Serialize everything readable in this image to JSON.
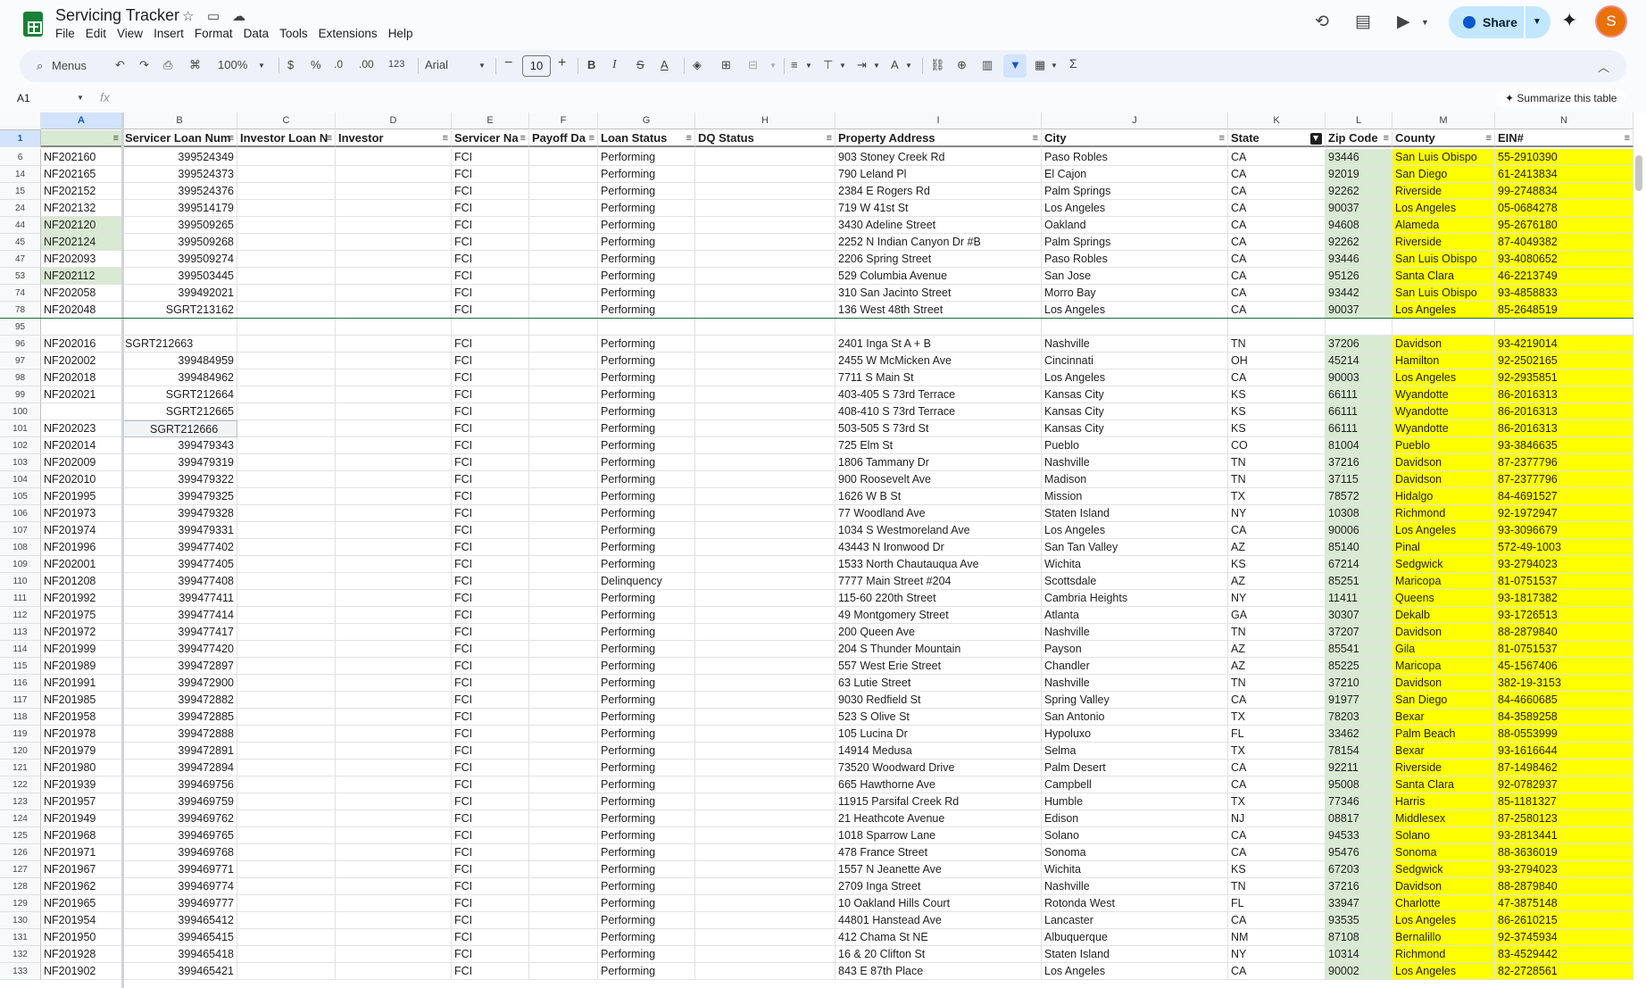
{
  "app": {
    "title": "Servicing Tracker",
    "menu": [
      "File",
      "Edit",
      "View",
      "Insert",
      "Format",
      "Data",
      "Tools",
      "Extensions",
      "Help"
    ],
    "share_label": "Share",
    "avatar_letter": "S"
  },
  "toolbar": {
    "menus_label": "Menus",
    "zoom": "100%",
    "currency": "$",
    "percent": "%",
    "dec_decrease": ".0",
    "dec_increase": ".00",
    "format_123": "123",
    "font": "Arial",
    "font_size": "10",
    "bold": "B",
    "italic": "I",
    "strike": "S",
    "text_color": "A",
    "sigma": "Σ"
  },
  "formula_bar": {
    "cell_ref": "A1",
    "fx": "fx",
    "summarize": "✦ Summarize this table"
  },
  "colors": {
    "zip_fill": "#d9ead3",
    "ein_fill": "#ffff00",
    "selected_header": "#d3e3fd",
    "share_btn": "#c2e7ff"
  },
  "columns": [
    "A",
    "B",
    "C",
    "D",
    "E",
    "F",
    "G",
    "H",
    "I",
    "J",
    "K",
    "L",
    "M",
    "N"
  ],
  "header_row_num": "1",
  "headers": [
    "",
    "Servicer Loan Num",
    "Investor Loan N",
    "Investor",
    "Servicer Na",
    "Payoff Da",
    "Loan Status",
    "DQ Status",
    "Property Address",
    "City",
    "State",
    "Zip Code",
    "County",
    "EIN#"
  ],
  "rows": [
    {
      "n": "6",
      "a": "NF202160",
      "b": "399524349",
      "e": "FCI",
      "g": "Performing",
      "i": "903 Stoney Creek Rd",
      "j": "Paso Robles",
      "k": "CA",
      "l": "93446",
      "m": "San Luis Obispo",
      "o": "55-2910390"
    },
    {
      "n": "14",
      "a": "NF202165",
      "b": "399524373",
      "e": "FCI",
      "g": "Performing",
      "i": "790 Leland Pl",
      "j": "El Cajon",
      "k": "CA",
      "l": "92019",
      "m": "San Diego",
      "o": "61-2413834"
    },
    {
      "n": "15",
      "a": "NF202152",
      "b": "399524376",
      "e": "FCI",
      "g": "Performing",
      "i": "2384 E Rogers Rd",
      "j": "Palm Springs",
      "k": "CA",
      "l": "92262",
      "m": "Riverside",
      "o": "99-2748834"
    },
    {
      "n": "24",
      "a": "NF202132",
      "b": "399514179",
      "e": "FCI",
      "g": "Performing",
      "i": "719 W 41st St",
      "j": "Los Angeles",
      "k": "CA",
      "l": "90037",
      "m": "Los Angeles",
      "o": "05-0684278"
    },
    {
      "n": "44",
      "a": "NF202120",
      "b": "399509265",
      "e": "FCI",
      "g": "Performing",
      "i": "3430 Adeline Street",
      "j": "Oakland",
      "k": "CA",
      "l": "94608",
      "m": "Alameda",
      "o": "95-2676180"
    },
    {
      "n": "45",
      "a": "NF202124",
      "b": "399509268",
      "e": "FCI",
      "g": "Performing",
      "i": "2252 N Indian Canyon Dr #B",
      "j": "Palm Springs",
      "k": "CA",
      "l": "92262",
      "m": "Riverside",
      "o": "87-4049382"
    },
    {
      "n": "47",
      "a": "NF202093",
      "b": "399509274",
      "e": "FCI",
      "g": "Performing",
      "i": "2206 Spring Street",
      "j": "Paso Robles",
      "k": "CA",
      "l": "93446",
      "m": "San Luis Obispo",
      "o": "93-4080652"
    },
    {
      "n": "53",
      "a": "NF202112",
      "b": "399503445",
      "e": "FCI",
      "g": "Performing",
      "i": "529 Columbia Avenue",
      "j": "San Jose",
      "k": "CA",
      "l": "95126",
      "m": "Santa Clara",
      "o": "46-2213749"
    },
    {
      "n": "74",
      "a": "NF202058",
      "b": "399492021",
      "e": "FCI",
      "g": "Performing",
      "i": "310 San Jacinto Street",
      "j": "Morro Bay",
      "k": "CA",
      "l": "93442",
      "m": "San Luis Obispo",
      "o": "93-4858833"
    },
    {
      "n": "78",
      "a": "NF202048",
      "b": "SGRT213162",
      "e": "FCI",
      "g": "Performing",
      "i": "136 West 48th Street",
      "j": "Los Angeles",
      "k": "CA",
      "l": "90037",
      "m": "Los Angeles",
      "o": "85-2648519"
    },
    {
      "n": "95",
      "a": "",
      "b": "",
      "e": "",
      "g": "",
      "i": "",
      "j": "",
      "k": "",
      "l": "",
      "m": "",
      "o": ""
    },
    {
      "n": "96",
      "a": "NF202016",
      "b": "SGRT212663",
      "e": "FCI",
      "g": "Performing",
      "i": "2401 Inga St A + B",
      "j": "Nashville",
      "k": "TN",
      "l": "37206",
      "m": "Davidson",
      "o": "93-4219014"
    },
    {
      "n": "97",
      "a": "NF202002",
      "b": "399484959",
      "e": "FCI",
      "g": "Performing",
      "i": "2455 W McMicken Ave",
      "j": "Cincinnati",
      "k": "OH",
      "l": "45214",
      "m": "Hamilton",
      "o": "92-2502165"
    },
    {
      "n": "98",
      "a": "NF202018",
      "b": "399484962",
      "e": "FCI",
      "g": "Performing",
      "i": "7711 S Main St",
      "j": "Los Angeles",
      "k": "CA",
      "l": "90003",
      "m": "Los Angeles",
      "o": "92-2935851"
    },
    {
      "n": "99",
      "a": "NF202021",
      "b": "SGRT212664",
      "e": "FCI",
      "g": "Performing",
      "i": "403-405 S 73rd Terrace",
      "j": "Kansas City",
      "k": "KS",
      "l": "66111",
      "m": "Wyandotte",
      "o": "86-2016313"
    },
    {
      "n": "100",
      "a": "",
      "b": "SGRT212665",
      "e": "FCI",
      "g": "Performing",
      "i": "408-410 S 73rd Terrace",
      "j": "Kansas City",
      "k": "KS",
      "l": "66111",
      "m": "Wyandotte",
      "o": "86-2016313"
    },
    {
      "n": "101",
      "a": "NF202023",
      "b": "SGRT212666",
      "e": "FCI",
      "g": "Performing",
      "i": "503-505 S 73rd St",
      "j": "Kansas City",
      "k": "KS",
      "l": "66111",
      "m": "Wyandotte",
      "o": "86-2016313"
    },
    {
      "n": "102",
      "a": "NF202014",
      "b": "399479343",
      "e": "FCI",
      "g": "Performing",
      "i": "725 Elm St",
      "j": "Pueblo",
      "k": "CO",
      "l": "81004",
      "m": "Pueblo",
      "o": "93-3846635"
    },
    {
      "n": "103",
      "a": "NF202009",
      "b": "399479319",
      "e": "FCI",
      "g": "Performing",
      "i": "1806 Tammany Dr",
      "j": "Nashville",
      "k": "TN",
      "l": "37216",
      "m": "Davidson",
      "o": "87-2377796"
    },
    {
      "n": "104",
      "a": "NF202010",
      "b": "399479322",
      "e": "FCI",
      "g": "Performing",
      "i": "900 Roosevelt Ave",
      "j": "Madison",
      "k": "TN",
      "l": "37115",
      "m": "Davidson",
      "o": "87-2377796"
    },
    {
      "n": "105",
      "a": "NF201995",
      "b": "399479325",
      "e": "FCI",
      "g": "Performing",
      "i": "1626 W B St",
      "j": "Mission",
      "k": "TX",
      "l": "78572",
      "m": "Hidalgo",
      "o": "84-4691527"
    },
    {
      "n": "106",
      "a": "NF201973",
      "b": "399479328",
      "e": "FCI",
      "g": "Performing",
      "i": "77 Woodland Ave",
      "j": "Staten Island",
      "k": "NY",
      "l": "10308",
      "m": "Richmond",
      "o": "92-1972947"
    },
    {
      "n": "107",
      "a": "NF201974",
      "b": "399479331",
      "e": "FCI",
      "g": "Performing",
      "i": "1034 S Westmoreland Ave",
      "j": "Los Angeles",
      "k": "CA",
      "l": "90006",
      "m": "Los Angeles",
      "o": "93-3096679"
    },
    {
      "n": "108",
      "a": "NF201996",
      "b": "399477402",
      "e": "FCI",
      "g": "Performing",
      "i": "43443 N Ironwood Dr",
      "j": "San Tan Valley",
      "k": "AZ",
      "l": "85140",
      "m": "Pinal",
      "o": "572-49-1003"
    },
    {
      "n": "109",
      "a": "NF202001",
      "b": "399477405",
      "e": "FCI",
      "g": "Performing",
      "i": "1533 North Chautauqua Ave",
      "j": "Wichita",
      "k": "KS",
      "l": "67214",
      "m": "Sedgwick",
      "o": "93-2794023"
    },
    {
      "n": "110",
      "a": "NF201208",
      "b": "399477408",
      "e": "FCI",
      "g": "Delinquency",
      "i": "7777 Main Street #204",
      "j": "Scottsdale",
      "k": "AZ",
      "l": "85251",
      "m": "Maricopa",
      "o": "81-0751537"
    },
    {
      "n": "111",
      "a": "NF201992",
      "b": "399477411",
      "e": "FCI",
      "g": "Performing",
      "i": "115-60 220th Street",
      "j": "Cambria Heights",
      "k": "NY",
      "l": "11411",
      "m": "Queens",
      "o": "93-1817382"
    },
    {
      "n": "112",
      "a": "NF201975",
      "b": "399477414",
      "e": "FCI",
      "g": "Performing",
      "i": "49 Montgomery Street",
      "j": "Atlanta",
      "k": "GA",
      "l": "30307",
      "m": "Dekalb",
      "o": "93-1726513"
    },
    {
      "n": "113",
      "a": "NF201972",
      "b": "399477417",
      "e": "FCI",
      "g": "Performing",
      "i": "200 Queen Ave",
      "j": "Nashville",
      "k": "TN",
      "l": "37207",
      "m": "Davidson",
      "o": "88-2879840"
    },
    {
      "n": "114",
      "a": "NF201999",
      "b": "399477420",
      "e": "FCI",
      "g": "Performing",
      "i": "204 S Thunder Mountain",
      "j": "Payson",
      "k": "AZ",
      "l": "85541",
      "m": "Gila",
      "o": "81-0751537"
    },
    {
      "n": "115",
      "a": "NF201989",
      "b": "399472897",
      "e": "FCI",
      "g": "Performing",
      "i": "557 West Erie Street",
      "j": "Chandler",
      "k": "AZ",
      "l": "85225",
      "m": "Maricopa",
      "o": "45-1567406"
    },
    {
      "n": "116",
      "a": "NF201991",
      "b": "399472900",
      "e": "FCI",
      "g": "Performing",
      "i": "63 Lutie Street",
      "j": "Nashville",
      "k": "TN",
      "l": "37210",
      "m": "Davidson",
      "o": "382-19-3153"
    },
    {
      "n": "117",
      "a": "NF201985",
      "b": "399472882",
      "e": "FCI",
      "g": "Performing",
      "i": "9030 Redfield St",
      "j": "Spring Valley",
      "k": "CA",
      "l": "91977",
      "m": "San Diego",
      "o": "84-4660685"
    },
    {
      "n": "118",
      "a": "NF201958",
      "b": "399472885",
      "e": "FCI",
      "g": "Performing",
      "i": "523 S Olive St",
      "j": "San Antonio",
      "k": "TX",
      "l": "78203",
      "m": "Bexar",
      "o": "84-3589258"
    },
    {
      "n": "119",
      "a": "NF201978",
      "b": "399472888",
      "e": "FCI",
      "g": "Performing",
      "i": "105 Lucina Dr",
      "j": "Hypoluxo",
      "k": "FL",
      "l": "33462",
      "m": "Palm Beach",
      "o": "88-0553999"
    },
    {
      "n": "120",
      "a": "NF201979",
      "b": "399472891",
      "e": "FCI",
      "g": "Performing",
      "i": "14914 Medusa",
      "j": "Selma",
      "k": "TX",
      "l": "78154",
      "m": "Bexar",
      "o": "93-1616644"
    },
    {
      "n": "121",
      "a": "NF201980",
      "b": "399472894",
      "e": "FCI",
      "g": "Performing",
      "i": "73520 Woodward Drive",
      "j": "Palm Desert",
      "k": "CA",
      "l": "92211",
      "m": "Riverside",
      "o": "87-1498462"
    },
    {
      "n": "122",
      "a": "NF201939",
      "b": "399469756",
      "e": "FCI",
      "g": "Performing",
      "i": "665 Hawthorne Ave",
      "j": "Campbell",
      "k": "CA",
      "l": "95008",
      "m": "Santa Clara",
      "o": "92-0782937"
    },
    {
      "n": "123",
      "a": "NF201957",
      "b": "399469759",
      "e": "FCI",
      "g": "Performing",
      "i": "11915 Parsifal Creek Rd",
      "j": "Humble",
      "k": "TX",
      "l": "77346",
      "m": "Harris",
      "o": "85-1181327"
    },
    {
      "n": "124",
      "a": "NF201949",
      "b": "399469762",
      "e": "FCI",
      "g": "Performing",
      "i": "21 Heathcote Avenue",
      "j": "Edison",
      "k": "NJ",
      "l": "08817",
      "m": "Middlesex",
      "o": "87-2580123"
    },
    {
      "n": "125",
      "a": "NF201968",
      "b": "399469765",
      "e": "FCI",
      "g": "Performing",
      "i": "1018 Sparrow Lane",
      "j": "Solano",
      "k": "CA",
      "l": "94533",
      "m": "Solano",
      "o": "93-2813441"
    },
    {
      "n": "126",
      "a": "NF201971",
      "b": "399469768",
      "e": "FCI",
      "g": "Performing",
      "i": "478 France Street",
      "j": "Sonoma",
      "k": "CA",
      "l": "95476",
      "m": "Sonoma",
      "o": "88-3636019"
    },
    {
      "n": "127",
      "a": "NF201967",
      "b": "399469771",
      "e": "FCI",
      "g": "Performing",
      "i": "1557 N Jeanette Ave",
      "j": "Wichita",
      "k": "KS",
      "l": "67203",
      "m": "Sedgwick",
      "o": "93-2794023"
    },
    {
      "n": "128",
      "a": "NF201962",
      "b": "399469774",
      "e": "FCI",
      "g": "Performing",
      "i": "2709 Inga Street",
      "j": "Nashville",
      "k": "TN",
      "l": "37216",
      "m": "Davidson",
      "o": "88-2879840"
    },
    {
      "n": "129",
      "a": "NF201965",
      "b": "399469777",
      "e": "FCI",
      "g": "Performing",
      "i": "10 Oakland Hills Court",
      "j": "Rotonda West",
      "k": "FL",
      "l": "33947",
      "m": "Charlotte",
      "o": "47-3875148"
    },
    {
      "n": "130",
      "a": "NF201954",
      "b": "399465412",
      "e": "FCI",
      "g": "Performing",
      "i": "44801 Hanstead Ave",
      "j": "Lancaster",
      "k": "CA",
      "l": "93535",
      "m": "Los Angeles",
      "o": "86-2610215"
    },
    {
      "n": "131",
      "a": "NF201950",
      "b": "399465415",
      "e": "FCI",
      "g": "Performing",
      "i": "412 Chama St NE",
      "j": "Albuquerque",
      "k": "NM",
      "l": "87108",
      "m": "Bernalillo",
      "o": "92-3745934"
    },
    {
      "n": "132",
      "a": "NF201928",
      "b": "399465418",
      "e": "FCI",
      "g": "Performing",
      "i": "16 & 20 Clifton St",
      "j": "Staten Island",
      "k": "NY",
      "l": "10314",
      "m": "Richmond",
      "o": "83-4529442"
    },
    {
      "n": "133",
      "a": "NF201902",
      "b": "399465421",
      "e": "FCI",
      "g": "Performing",
      "i": "843 E 87th Place",
      "j": "Los Angeles",
      "k": "CA",
      "l": "90002",
      "m": "Los Angeles",
      "o": "82-2728561"
    }
  ]
}
